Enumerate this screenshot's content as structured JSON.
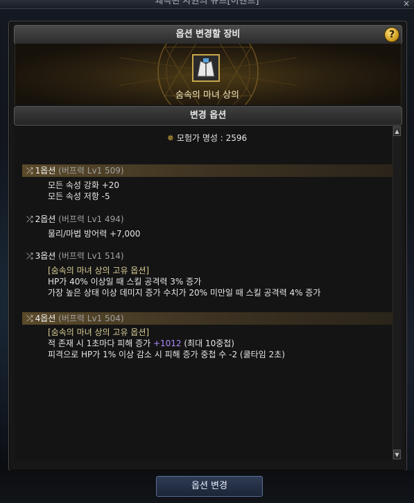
{
  "window": {
    "title": "왜곡된 차원의 큐브[이벤트]",
    "close_label": "×"
  },
  "header": {
    "title": "옵션 변경할 장비",
    "help_label": "?"
  },
  "item": {
    "name": "숨속의 마녀 상의"
  },
  "options_header": "변경 옵션",
  "renown": {
    "label": "모험가 명성",
    "separator": " : ",
    "value": "2596"
  },
  "options": [
    {
      "num": "1옵션",
      "power": "(버프력 Lv1 509)",
      "lines": [
        "모든 속성 강화 +20",
        "모든 속성 저항 -5"
      ]
    },
    {
      "num": "2옵션",
      "power": "(버프력 Lv1 494)",
      "lines": [
        "물리/마법 방어력 +7,000"
      ]
    },
    {
      "num": "3옵션",
      "power": "(버프력 Lv1 514)",
      "unique": "[숨속의 마녀 상의 고유 옵션]",
      "lines": [
        "HP가 40% 이상일 때 스킬 공격력 3% 증가",
        "가장 높은 상태 이상 데미지 증가 수치가 20% 미만일 때 스킬 공격력 4% 증가"
      ]
    },
    {
      "num": "4옵션",
      "power": "(버프력 Lv1 504)",
      "unique": "[숨속의 마녀 상의 고유 옵션]",
      "line1_a": "적 존재 시 1초마다 피해 증가 ",
      "line1_b": "+1012",
      "line1_c": " (최대 10중첩)",
      "line2": "피격으로 HP가 1% 이상 감소 시 피해 증가 중첩 수 -2 (쿨타임 2초)"
    }
  ],
  "change_button": "옵션 변경",
  "colors": {
    "accent_gold": "#d9cd96",
    "purple_value": "#b08cff"
  }
}
